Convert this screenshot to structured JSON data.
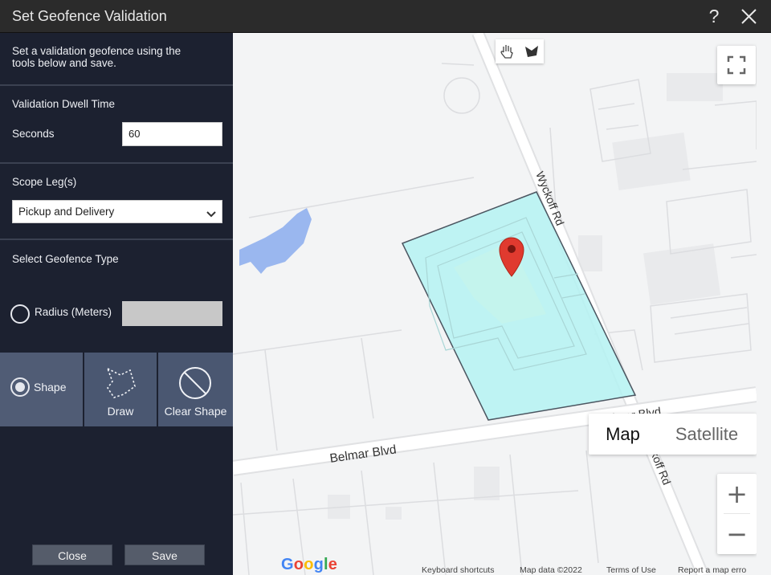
{
  "dialog": {
    "title": "Set Geofence Validation",
    "help_label": "?"
  },
  "panel": {
    "intro": "Set a validation geofence using the tools below and save.",
    "dwell": {
      "heading": "Validation Dwell Time",
      "seconds_label": "Seconds",
      "seconds_value": "60"
    },
    "scope": {
      "heading": "Scope Leg(s)",
      "selected": "Pickup and Delivery"
    },
    "geofence_type": {
      "heading": "Select Geofence Type",
      "radius_label": "Radius (Meters)",
      "radius_value": "",
      "radius_checked": false,
      "shape_label": "Shape",
      "shape_checked": true,
      "draw_label": "Draw",
      "clear_label": "Clear Shape"
    },
    "buttons": {
      "close": "Close",
      "save": "Save"
    }
  },
  "map": {
    "roads": {
      "belmar_main": "Belmar Blvd",
      "belmar_upper": "Belmar Blvd",
      "wyckoff": "Wyckoff Rd",
      "wyckoff_lower": "koff Rd"
    },
    "map_type": {
      "map": "Map",
      "satellite": "Satellite",
      "selected": "Map"
    },
    "zoom": {
      "in": "+",
      "out": "−"
    },
    "attribution": {
      "logo": "Google",
      "keyboard": "Keyboard shortcuts",
      "map_data": "Map data ©2022",
      "terms": "Terms of Use",
      "report": "Report a map erro"
    },
    "colors": {
      "geofence_fill": "#b4f2f2",
      "geofence_stroke": "#4b5560",
      "water": "#9ab7ef",
      "marker": "#e03a2f"
    },
    "icons": [
      "hand-icon",
      "polygon-draw-icon",
      "fullscreen-icon",
      "map-marker-icon"
    ]
  }
}
